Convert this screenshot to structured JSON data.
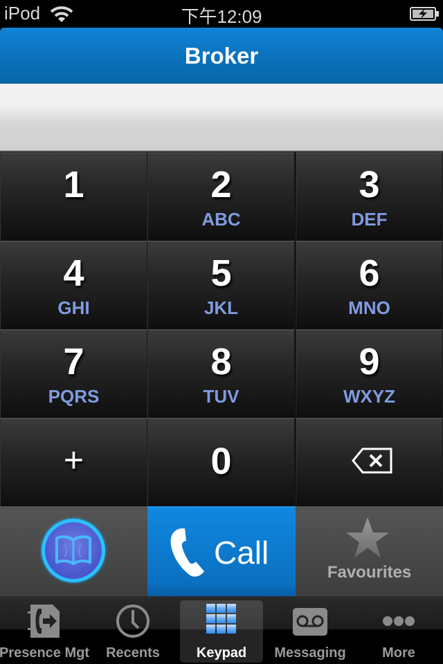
{
  "status_bar": {
    "carrier": "iPod",
    "time": "下午12:09",
    "wifi_icon": "wifi-icon",
    "battery_icon": "battery-charging-icon"
  },
  "nav_bar": {
    "title": "Broker"
  },
  "display": {
    "value": ""
  },
  "keypad": {
    "keys": [
      {
        "digit": "1",
        "letters": ""
      },
      {
        "digit": "2",
        "letters": "ABC"
      },
      {
        "digit": "3",
        "letters": "DEF"
      },
      {
        "digit": "4",
        "letters": "GHI"
      },
      {
        "digit": "5",
        "letters": "JKL"
      },
      {
        "digit": "6",
        "letters": "MNO"
      },
      {
        "digit": "7",
        "letters": "PQRS"
      },
      {
        "digit": "8",
        "letters": "TUV"
      },
      {
        "digit": "9",
        "letters": "WXYZ"
      },
      {
        "digit": "+",
        "letters": ""
      },
      {
        "digit": "0",
        "letters": ""
      },
      {
        "digit": "",
        "letters": "",
        "icon": "backspace-icon"
      }
    ]
  },
  "actions": {
    "contacts_icon": "book-icon",
    "call_label": "Call",
    "call_icon": "phone-icon",
    "favourites_label": "Favourites",
    "favourites_icon": "star-icon"
  },
  "tab_bar": {
    "tabs": [
      {
        "label": "Presence Mgt",
        "icon": "presence-icon",
        "active": false
      },
      {
        "label": "Recents",
        "icon": "clock-icon",
        "active": false
      },
      {
        "label": "Keypad",
        "icon": "keypad-icon",
        "active": true
      },
      {
        "label": "Messaging",
        "icon": "voicemail-icon",
        "active": false
      },
      {
        "label": "More",
        "icon": "more-icon",
        "active": false
      }
    ]
  },
  "colors": {
    "nav_blue": "#0a6fb8",
    "call_blue": "#0a78cc",
    "letters_blue": "#7f9be0",
    "ring_cyan": "#2ac0ff"
  }
}
